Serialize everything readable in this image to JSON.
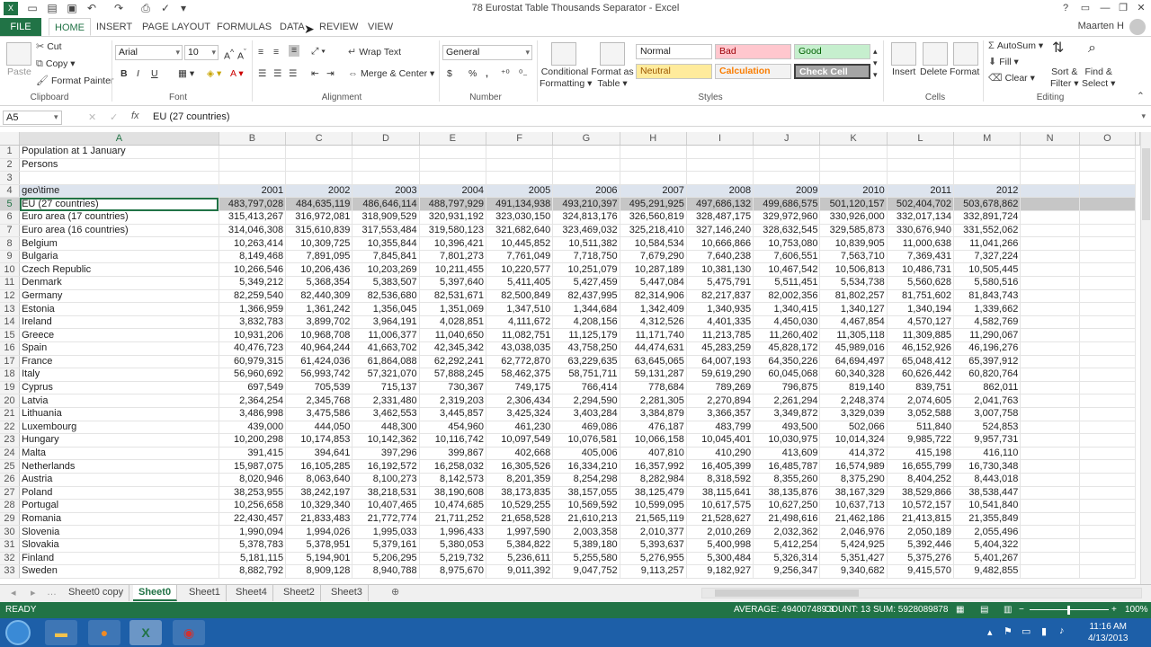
{
  "app": {
    "title": "78 Eurostat Table Thousands Separator - Excel",
    "user": "Maarten H",
    "window_controls": [
      "?",
      "▭",
      "—",
      "❐",
      "✕"
    ]
  },
  "tabs": [
    "FILE",
    "HOME",
    "INSERT",
    "PAGE LAYOUT",
    "FORMULAS",
    "DATA",
    "REVIEW",
    "VIEW"
  ],
  "ribbon": {
    "clipboard": {
      "paste": "Paste",
      "cut": "Cut",
      "copy": "Copy",
      "format_painter": "Format Painter",
      "label": "Clipboard"
    },
    "font": {
      "name": "Arial",
      "size": "10",
      "bold": "B",
      "italic": "I",
      "underline": "U",
      "label": "Font"
    },
    "alignment": {
      "wrap": "Wrap Text",
      "merge": "Merge & Center",
      "label": "Alignment"
    },
    "number": {
      "format": "General",
      "currency": "$",
      "percent": "%",
      "comma": ",",
      "label": "Number"
    },
    "styles": {
      "conditional": "Conditional",
      "conditional2": "Formatting",
      "format_as": "Format as",
      "format_as2": "Table",
      "normal": "Normal",
      "bad": "Bad",
      "good": "Good",
      "neutral": "Neutral",
      "calculation": "Calculation",
      "check": "Check Cell",
      "label": "Styles"
    },
    "cells": {
      "insert": "Insert",
      "delete": "Delete",
      "format": "Format",
      "label": "Cells"
    },
    "editing": {
      "autosum": "AutoSum",
      "fill": "Fill",
      "clear": "Clear",
      "sort": "Sort &",
      "sort2": "Filter",
      "find": "Find &",
      "find2": "Select",
      "label": "Editing"
    }
  },
  "formula_bar": {
    "cell": "A5",
    "fx": "fx",
    "content": "EU (27 countries)"
  },
  "columns": [
    "A",
    "B",
    "C",
    "D",
    "E",
    "F",
    "G",
    "H",
    "I",
    "J",
    "K",
    "L",
    "M",
    "N",
    "O"
  ],
  "rows": [
    {
      "n": "1",
      "a": "Population at 1 January",
      "v": []
    },
    {
      "n": "2",
      "a": "Persons",
      "v": []
    },
    {
      "n": "3",
      "a": "",
      "v": []
    },
    {
      "n": "4",
      "a": "geo\\time",
      "v": [
        "2001",
        "2002",
        "2003",
        "2004",
        "2005",
        "2006",
        "2007",
        "2008",
        "2009",
        "2010",
        "2011",
        "2012"
      ]
    },
    {
      "n": "5",
      "a": "EU (27 countries)",
      "v": [
        "483,797,028",
        "484,635,119",
        "486,646,114",
        "488,797,929",
        "491,134,938",
        "493,210,397",
        "495,291,925",
        "497,686,132",
        "499,686,575",
        "501,120,157",
        "502,404,702",
        "503,678,862"
      ]
    },
    {
      "n": "6",
      "a": "Euro area (17 countries)",
      "v": [
        "315,413,267",
        "316,972,081",
        "318,909,529",
        "320,931,192",
        "323,030,150",
        "324,813,176",
        "326,560,819",
        "328,487,175",
        "329,972,960",
        "330,926,000",
        "332,017,134",
        "332,891,724"
      ]
    },
    {
      "n": "7",
      "a": "Euro area (16 countries)",
      "v": [
        "314,046,308",
        "315,610,839",
        "317,553,484",
        "319,580,123",
        "321,682,640",
        "323,469,032",
        "325,218,410",
        "327,146,240",
        "328,632,545",
        "329,585,873",
        "330,676,940",
        "331,552,062"
      ]
    },
    {
      "n": "8",
      "a": "Belgium",
      "v": [
        "10,263,414",
        "10,309,725",
        "10,355,844",
        "10,396,421",
        "10,445,852",
        "10,511,382",
        "10,584,534",
        "10,666,866",
        "10,753,080",
        "10,839,905",
        "11,000,638",
        "11,041,266"
      ]
    },
    {
      "n": "9",
      "a": "Bulgaria",
      "v": [
        "8,149,468",
        "7,891,095",
        "7,845,841",
        "7,801,273",
        "7,761,049",
        "7,718,750",
        "7,679,290",
        "7,640,238",
        "7,606,551",
        "7,563,710",
        "7,369,431",
        "7,327,224"
      ]
    },
    {
      "n": "10",
      "a": "Czech Republic",
      "v": [
        "10,266,546",
        "10,206,436",
        "10,203,269",
        "10,211,455",
        "10,220,577",
        "10,251,079",
        "10,287,189",
        "10,381,130",
        "10,467,542",
        "10,506,813",
        "10,486,731",
        "10,505,445"
      ]
    },
    {
      "n": "11",
      "a": "Denmark",
      "v": [
        "5,349,212",
        "5,368,354",
        "5,383,507",
        "5,397,640",
        "5,411,405",
        "5,427,459",
        "5,447,084",
        "5,475,791",
        "5,511,451",
        "5,534,738",
        "5,560,628",
        "5,580,516"
      ]
    },
    {
      "n": "12",
      "a": "Germany",
      "v": [
        "82,259,540",
        "82,440,309",
        "82,536,680",
        "82,531,671",
        "82,500,849",
        "82,437,995",
        "82,314,906",
        "82,217,837",
        "82,002,356",
        "81,802,257",
        "81,751,602",
        "81,843,743"
      ]
    },
    {
      "n": "13",
      "a": "Estonia",
      "v": [
        "1,366,959",
        "1,361,242",
        "1,356,045",
        "1,351,069",
        "1,347,510",
        "1,344,684",
        "1,342,409",
        "1,340,935",
        "1,340,415",
        "1,340,127",
        "1,340,194",
        "1,339,662"
      ]
    },
    {
      "n": "14",
      "a": "Ireland",
      "v": [
        "3,832,783",
        "3,899,702",
        "3,964,191",
        "4,028,851",
        "4,111,672",
        "4,208,156",
        "4,312,526",
        "4,401,335",
        "4,450,030",
        "4,467,854",
        "4,570,127",
        "4,582,769"
      ]
    },
    {
      "n": "15",
      "a": "Greece",
      "v": [
        "10,931,206",
        "10,968,708",
        "11,006,377",
        "11,040,650",
        "11,082,751",
        "11,125,179",
        "11,171,740",
        "11,213,785",
        "11,260,402",
        "11,305,118",
        "11,309,885",
        "11,290,067"
      ]
    },
    {
      "n": "16",
      "a": "Spain",
      "v": [
        "40,476,723",
        "40,964,244",
        "41,663,702",
        "42,345,342",
        "43,038,035",
        "43,758,250",
        "44,474,631",
        "45,283,259",
        "45,828,172",
        "45,989,016",
        "46,152,926",
        "46,196,276"
      ]
    },
    {
      "n": "17",
      "a": "France",
      "v": [
        "60,979,315",
        "61,424,036",
        "61,864,088",
        "62,292,241",
        "62,772,870",
        "63,229,635",
        "63,645,065",
        "64,007,193",
        "64,350,226",
        "64,694,497",
        "65,048,412",
        "65,397,912"
      ]
    },
    {
      "n": "18",
      "a": "Italy",
      "v": [
        "56,960,692",
        "56,993,742",
        "57,321,070",
        "57,888,245",
        "58,462,375",
        "58,751,711",
        "59,131,287",
        "59,619,290",
        "60,045,068",
        "60,340,328",
        "60,626,442",
        "60,820,764"
      ]
    },
    {
      "n": "19",
      "a": "Cyprus",
      "v": [
        "697,549",
        "705,539",
        "715,137",
        "730,367",
        "749,175",
        "766,414",
        "778,684",
        "789,269",
        "796,875",
        "819,140",
        "839,751",
        "862,011"
      ]
    },
    {
      "n": "20",
      "a": "Latvia",
      "v": [
        "2,364,254",
        "2,345,768",
        "2,331,480",
        "2,319,203",
        "2,306,434",
        "2,294,590",
        "2,281,305",
        "2,270,894",
        "2,261,294",
        "2,248,374",
        "2,074,605",
        "2,041,763"
      ]
    },
    {
      "n": "21",
      "a": "Lithuania",
      "v": [
        "3,486,998",
        "3,475,586",
        "3,462,553",
        "3,445,857",
        "3,425,324",
        "3,403,284",
        "3,384,879",
        "3,366,357",
        "3,349,872",
        "3,329,039",
        "3,052,588",
        "3,007,758"
      ]
    },
    {
      "n": "22",
      "a": "Luxembourg",
      "v": [
        "439,000",
        "444,050",
        "448,300",
        "454,960",
        "461,230",
        "469,086",
        "476,187",
        "483,799",
        "493,500",
        "502,066",
        "511,840",
        "524,853"
      ]
    },
    {
      "n": "23",
      "a": "Hungary",
      "v": [
        "10,200,298",
        "10,174,853",
        "10,142,362",
        "10,116,742",
        "10,097,549",
        "10,076,581",
        "10,066,158",
        "10,045,401",
        "10,030,975",
        "10,014,324",
        "9,985,722",
        "9,957,731"
      ]
    },
    {
      "n": "24",
      "a": "Malta",
      "v": [
        "391,415",
        "394,641",
        "397,296",
        "399,867",
        "402,668",
        "405,006",
        "407,810",
        "410,290",
        "413,609",
        "414,372",
        "415,198",
        "416,110"
      ]
    },
    {
      "n": "25",
      "a": "Netherlands",
      "v": [
        "15,987,075",
        "16,105,285",
        "16,192,572",
        "16,258,032",
        "16,305,526",
        "16,334,210",
        "16,357,992",
        "16,405,399",
        "16,485,787",
        "16,574,989",
        "16,655,799",
        "16,730,348"
      ]
    },
    {
      "n": "26",
      "a": "Austria",
      "v": [
        "8,020,946",
        "8,063,640",
        "8,100,273",
        "8,142,573",
        "8,201,359",
        "8,254,298",
        "8,282,984",
        "8,318,592",
        "8,355,260",
        "8,375,290",
        "8,404,252",
        "8,443,018"
      ]
    },
    {
      "n": "27",
      "a": "Poland",
      "v": [
        "38,253,955",
        "38,242,197",
        "38,218,531",
        "38,190,608",
        "38,173,835",
        "38,157,055",
        "38,125,479",
        "38,115,641",
        "38,135,876",
        "38,167,329",
        "38,529,866",
        "38,538,447"
      ]
    },
    {
      "n": "28",
      "a": "Portugal",
      "v": [
        "10,256,658",
        "10,329,340",
        "10,407,465",
        "10,474,685",
        "10,529,255",
        "10,569,592",
        "10,599,095",
        "10,617,575",
        "10,627,250",
        "10,637,713",
        "10,572,157",
        "10,541,840"
      ]
    },
    {
      "n": "29",
      "a": "Romania",
      "v": [
        "22,430,457",
        "21,833,483",
        "21,772,774",
        "21,711,252",
        "21,658,528",
        "21,610,213",
        "21,565,119",
        "21,528,627",
        "21,498,616",
        "21,462,186",
        "21,413,815",
        "21,355,849"
      ]
    },
    {
      "n": "30",
      "a": "Slovenia",
      "v": [
        "1,990,094",
        "1,994,026",
        "1,995,033",
        "1,996,433",
        "1,997,590",
        "2,003,358",
        "2,010,377",
        "2,010,269",
        "2,032,362",
        "2,046,976",
        "2,050,189",
        "2,055,496"
      ]
    },
    {
      "n": "31",
      "a": "Slovakia",
      "v": [
        "5,378,783",
        "5,378,951",
        "5,379,161",
        "5,380,053",
        "5,384,822",
        "5,389,180",
        "5,393,637",
        "5,400,998",
        "5,412,254",
        "5,424,925",
        "5,392,446",
        "5,404,322"
      ]
    },
    {
      "n": "32",
      "a": "Finland",
      "v": [
        "5,181,115",
        "5,194,901",
        "5,206,295",
        "5,219,732",
        "5,236,611",
        "5,255,580",
        "5,276,955",
        "5,300,484",
        "5,326,314",
        "5,351,427",
        "5,375,276",
        "5,401,267"
      ]
    },
    {
      "n": "33",
      "a": "Sweden",
      "v": [
        "8,882,792",
        "8,909,128",
        "8,940,788",
        "8,975,670",
        "9,011,392",
        "9,047,752",
        "9,113,257",
        "9,182,927",
        "9,256,347",
        "9,340,682",
        "9,415,570",
        "9,482,855"
      ]
    }
  ],
  "sheets": [
    "Sheet0 copy",
    "Sheet0",
    "Sheet1",
    "Sheet4",
    "Sheet2",
    "Sheet3"
  ],
  "active_sheet": "Sheet0",
  "status": {
    "ready": "READY",
    "average": "AVERAGE: 494007489.8",
    "count": "COUNT: 13",
    "sum": "SUM: 5928089878",
    "zoom": "100%"
  },
  "taskbar": {
    "time": "11:16 AM",
    "date": "4/13/2013"
  },
  "colors": {
    "excel_green": "#217346",
    "taskbar_blue": "#1d5fa8"
  }
}
